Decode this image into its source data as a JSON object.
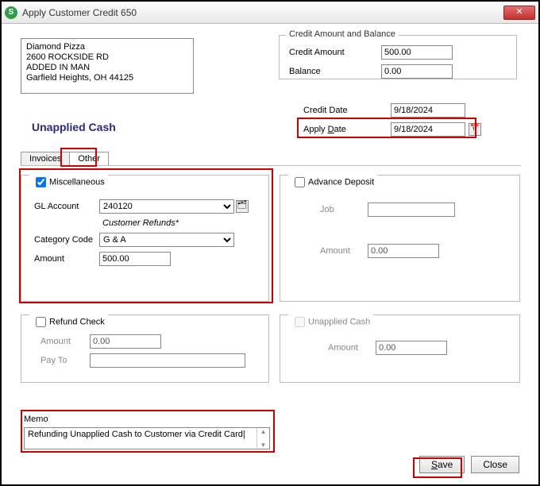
{
  "window": {
    "title": "Apply Customer Credit 650"
  },
  "customer": {
    "line1": "Diamond Pizza",
    "line2": "2600 ROCKSIDE RD",
    "line3": "ADDED IN MAN",
    "line4": "Garfield Heights, OH  44125"
  },
  "credit": {
    "group_label": "Credit Amount and Balance",
    "amount_label": "Credit Amount",
    "amount": "500.00",
    "balance_label": "Balance",
    "balance": "0.00"
  },
  "dates": {
    "credit_date_label": "Credit Date",
    "credit_date": "9/18/2024",
    "apply_date_label": "Apply Date",
    "apply_date": "9/18/2024"
  },
  "section_title": "Unapplied Cash",
  "tabs": {
    "invoices": "Invoices",
    "other": "Other"
  },
  "misc": {
    "group_label": "Miscellaneous",
    "gl_label": "GL Account",
    "gl_value": "240120",
    "gl_desc": "Customer Refunds*",
    "cat_label": "Category Code",
    "cat_value": "G & A",
    "amount_label": "Amount",
    "amount": "500.00"
  },
  "adv": {
    "group_label": "Advance Deposit",
    "job_label": "Job",
    "job_value": "",
    "amount_label": "Amount",
    "amount": "0.00"
  },
  "refund": {
    "group_label": "Refund Check",
    "amount_label": "Amount",
    "amount": "0.00",
    "payto_label": "Pay To",
    "payto": ""
  },
  "unapp": {
    "group_label": "Unapplied Cash",
    "amount_label": "Amount",
    "amount": "0.00"
  },
  "memo": {
    "label": "Memo",
    "text": "Refunding Unapplied Cash to Customer via Credit Card"
  },
  "buttons": {
    "save": "Save",
    "close": "Close"
  }
}
